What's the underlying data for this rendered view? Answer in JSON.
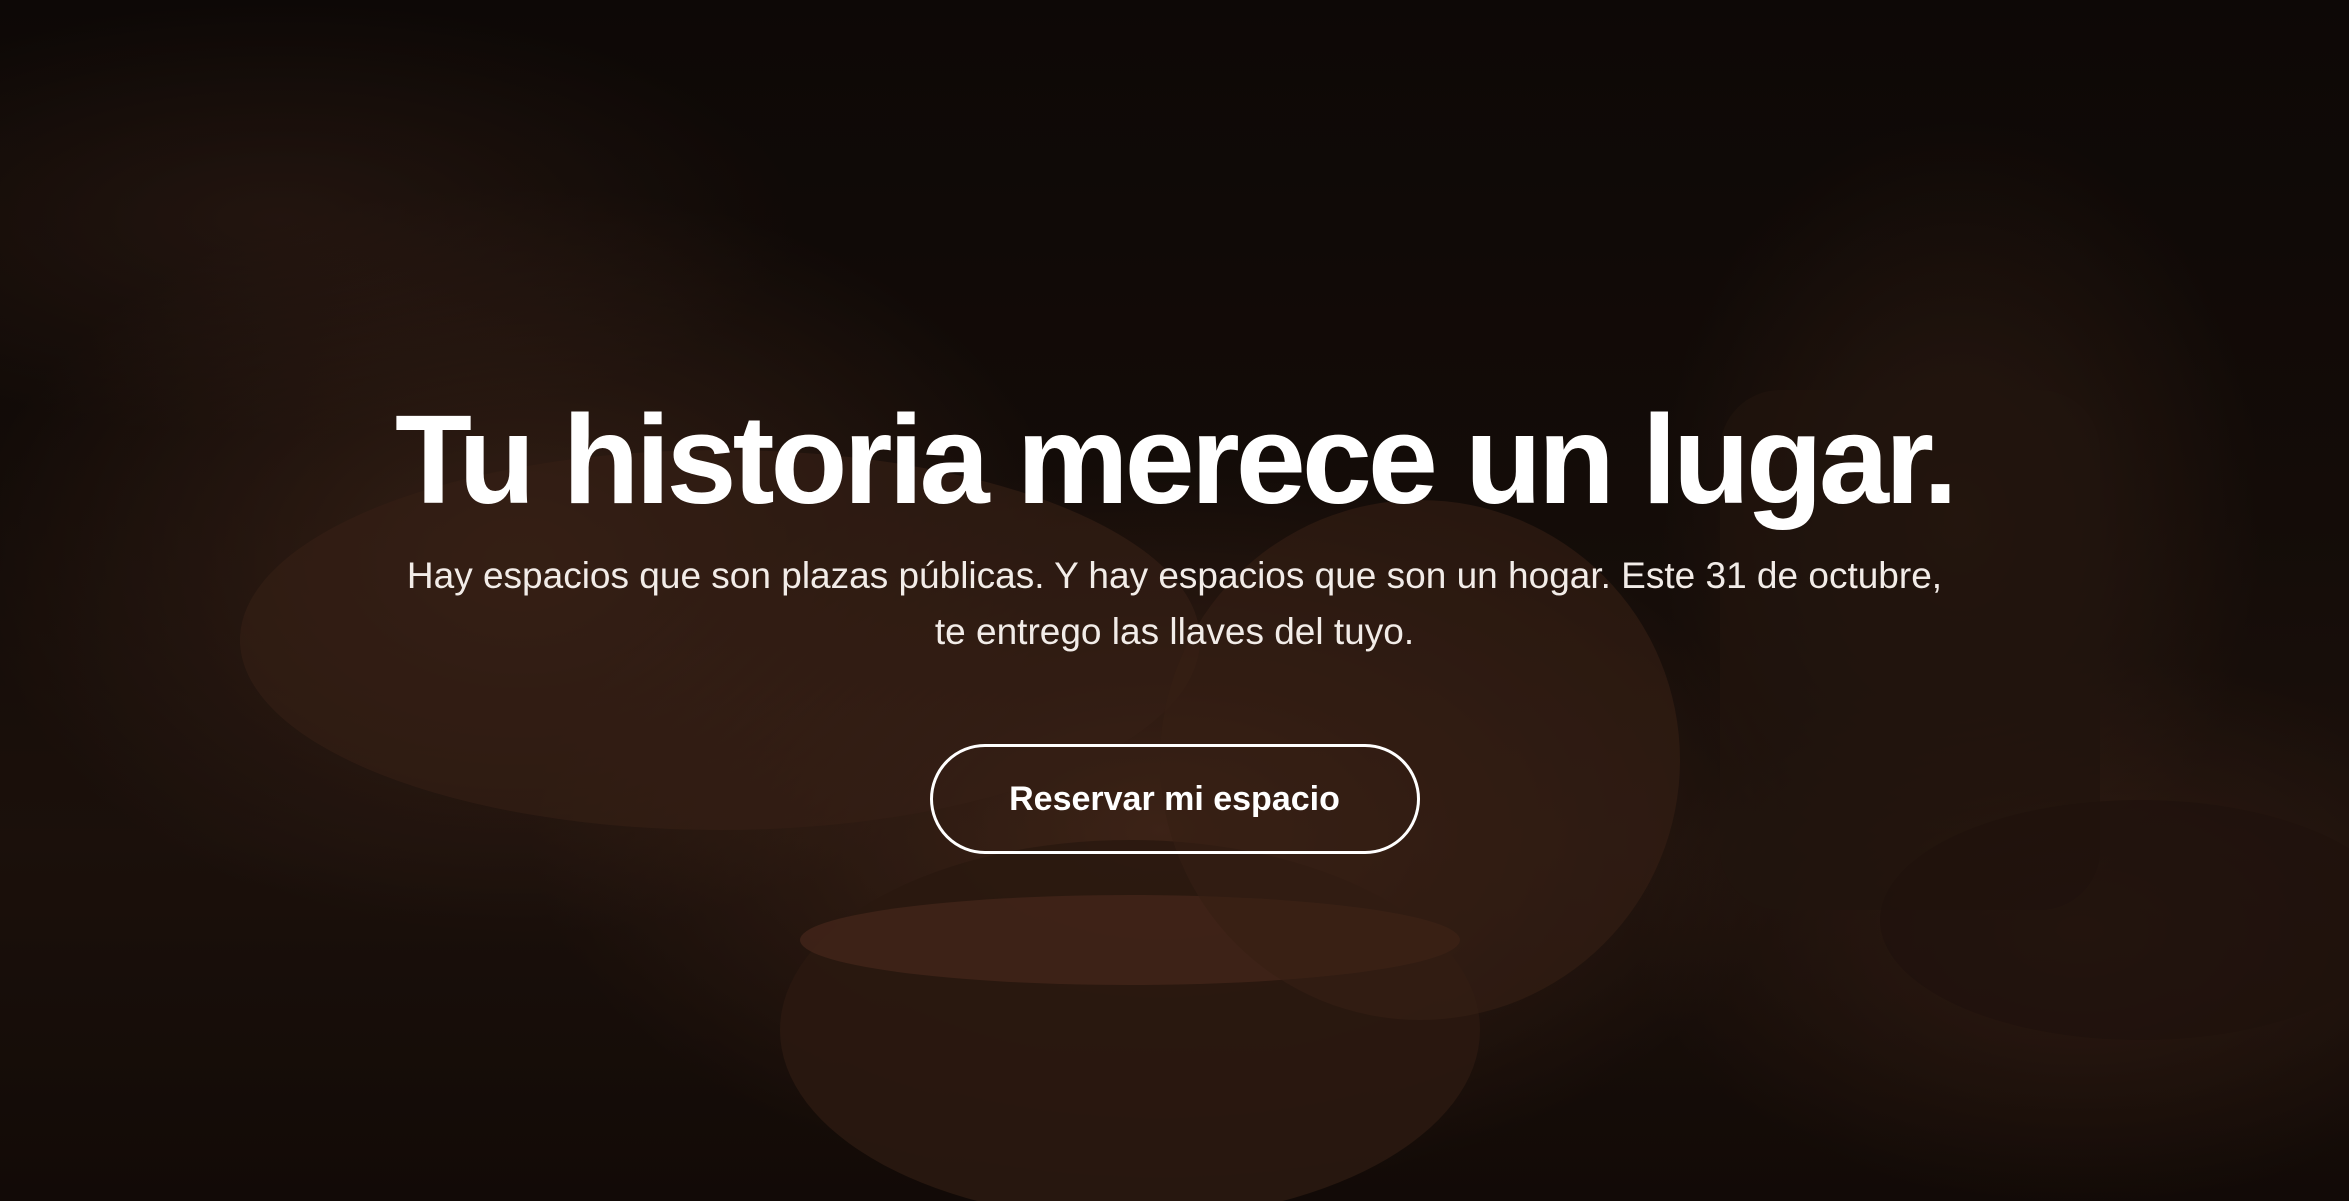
{
  "hero": {
    "background_image": "pottery-hands-shaping-clay-bowl",
    "title": "Tu historia merece un lugar.",
    "subtitle": "Hay espacios que son plazas públicas. Y hay espacios que son un hogar. Este 31 de octubre, te entrego las llaves del tuyo.",
    "cta_label": "Reservar mi espacio"
  },
  "colors": {
    "text": "#ffffff",
    "overlay": "#000000",
    "clay": "#7a462d"
  }
}
